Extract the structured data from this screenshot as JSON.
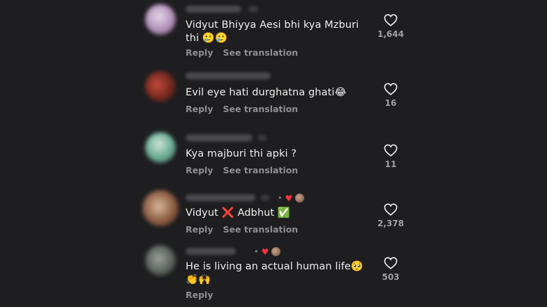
{
  "actions": {
    "reply_label": "Reply",
    "translate_label": "See translation"
  },
  "comments": [
    {
      "text": "Vidyut Bhiyya Aesi bhi kya Mzburi thi 🥲🥲",
      "likes": "1,644",
      "has_translation": true,
      "author_liked": false
    },
    {
      "text": "Evil eye hati durghatna ghati😂",
      "likes": "16",
      "has_translation": true,
      "author_liked": false
    },
    {
      "text": "Kya majburi thi apki ?",
      "likes": "11",
      "has_translation": true,
      "author_liked": false
    },
    {
      "text": "Vidyut ❌ Adbhut ✅",
      "likes": "2,378",
      "has_translation": true,
      "author_liked": true
    },
    {
      "text": "He is living an actual human life🥺👏🙌",
      "likes": "503",
      "has_translation": false,
      "author_liked": true
    }
  ],
  "colors": {
    "background": "#1e1e20",
    "text": "#f0f0f0",
    "muted": "#8e8e93",
    "author_heart": "#ff3040"
  },
  "icons": {
    "like": "heart-outline-icon",
    "author_like": "heart-filled-icon"
  }
}
